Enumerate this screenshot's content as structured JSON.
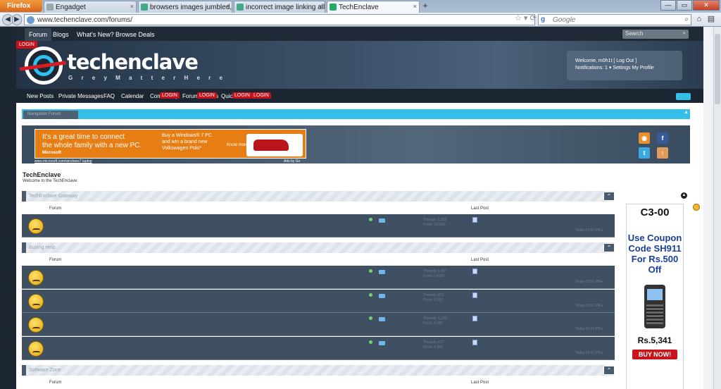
{
  "browser": {
    "app_button": "Firefox",
    "tabs": [
      {
        "label": "Engadget",
        "active": false
      },
      {
        "label": "browsers images jumbled, all...",
        "active": false
      },
      {
        "label": "incorrect image linking all br...",
        "active": false
      },
      {
        "label": "TechEnclave",
        "active": true
      }
    ],
    "url": "www.techenclave.com/forums/",
    "search_placeholder": "Google"
  },
  "site": {
    "top_nav": [
      "Forum",
      "Blogs",
      "What's New?",
      "Browse Deals"
    ],
    "search_label": "Search",
    "login_tag": "LOGIN",
    "logo_text": "techenclave",
    "logo_tagline": "G r e y   M a t t e r   H e r e",
    "welcome_line": "Welcome, m0h1t   [ Log Out ]",
    "welcome_links": "Notifications: 1 ▾    Settings   My Profile",
    "sub_nav": [
      "New Posts",
      "Private Messages",
      "FAQ",
      "Calendar",
      "Community",
      "Forum Actions",
      "Quick Links"
    ],
    "red_tags": [
      "LOGIN",
      "LOGIN",
      "LOGIN",
      "LOGIN"
    ],
    "breadcrumb": "Navigation      Forum",
    "title": "TechEnclave",
    "subtitle": "Welcome to the TechEnclave."
  },
  "ad": {
    "line1": "It's a great time to connect",
    "line2": "the whole family with a new PC.",
    "promo1": "Buy a Windows® 7 PC",
    "promo2": "and win a brand new",
    "promo3": "Volkswagen Polo*",
    "brand": "Microsoft",
    "cta": "Know more",
    "url": "www.microsoft.com/windows7-laptop",
    "by": "Ads by Go"
  },
  "forum": {
    "col_forum": "Forum",
    "col_last_post": "Last Post",
    "categories": [
      {
        "title": "TechEnclave Gateway",
        "rows": [
          {
            "meta": "Threads: 1,838\nPosts: 15,889",
            "time": "Today 01:50 PM ▸"
          }
        ]
      },
      {
        "title": "Buying Help",
        "rows": [
          {
            "meta": "Threads: 1,807\nPosts: 14,892",
            "time": "Today 02:09 PM ▸"
          },
          {
            "meta": "Threads: 872\nPosts: 6,093",
            "time": "Today 01:51 PM ▸"
          },
          {
            "meta": "Threads: 1,196\nPosts: 9,085",
            "time": "Today 01:44 PM ▸"
          },
          {
            "meta": "Threads: 617\nPosts: 4,384",
            "time": "Today 02:07 PM ▸"
          }
        ]
      },
      {
        "title": "Software Zone",
        "rows": []
      }
    ]
  },
  "side_ad": {
    "model": "C3-00",
    "promo": "Use Coupon Code SH911 For Rs.500 Off",
    "price": "Rs.5,341",
    "button": "BUY NOW!"
  }
}
